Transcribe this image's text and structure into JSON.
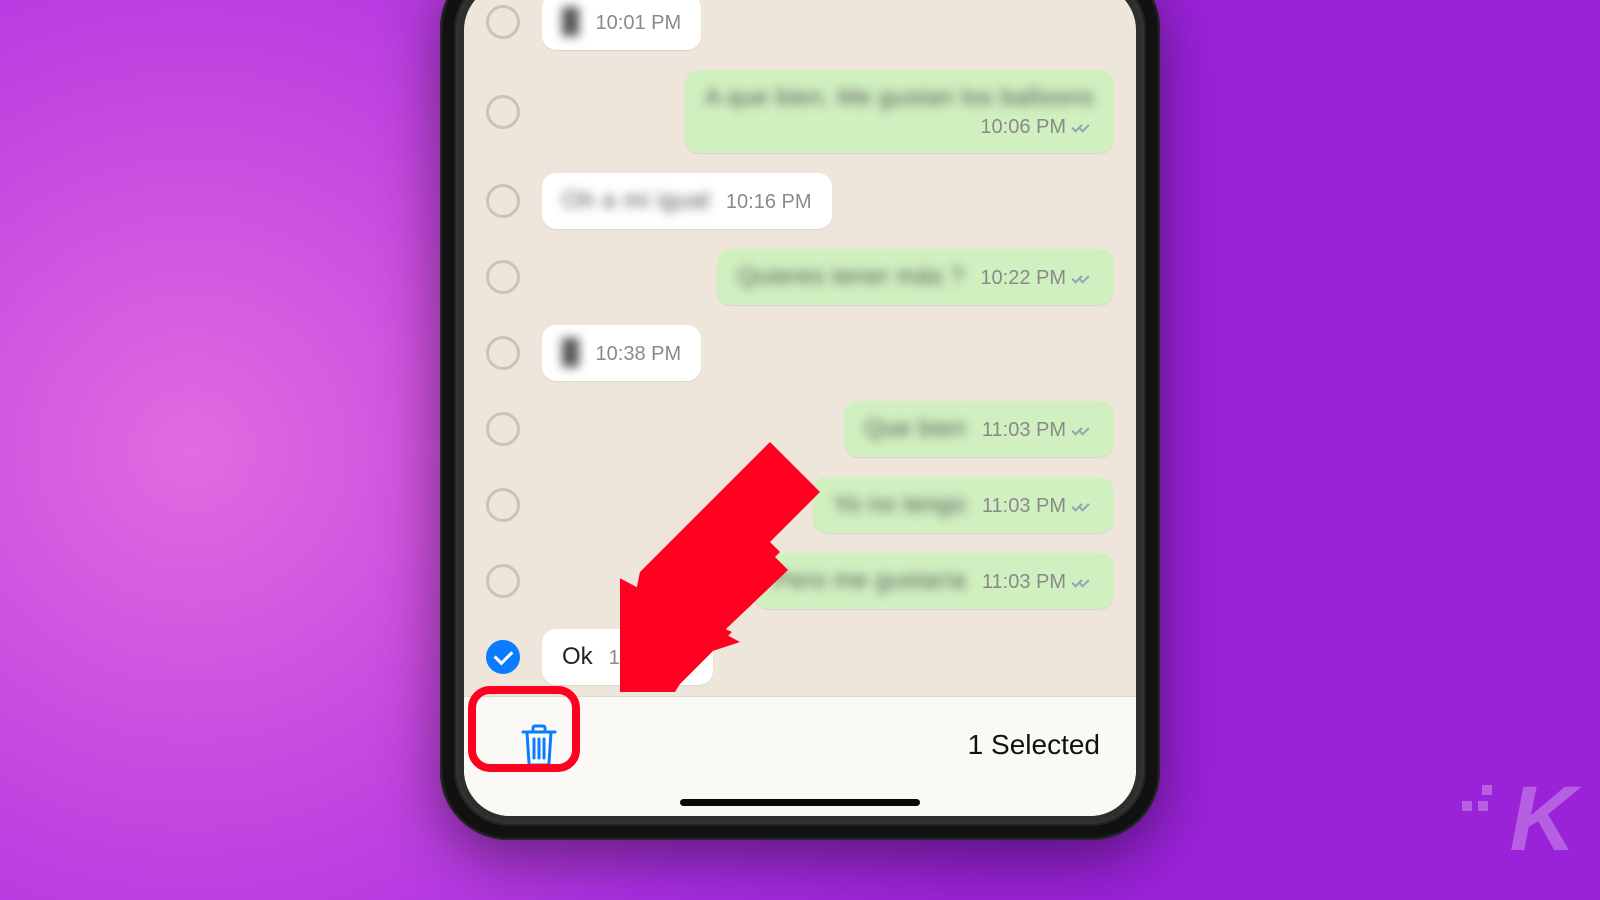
{
  "toolbar": {
    "selected_label": "1 Selected"
  },
  "messages": [
    {
      "side": "received",
      "text": "█",
      "time": "10:01 PM",
      "blur": true,
      "ticks": false,
      "selected": false
    },
    {
      "side": "sent",
      "text": "A que bien. Me gustan los balloons",
      "time": "10:06 PM",
      "blur": true,
      "ticks": true,
      "selected": false,
      "long": true
    },
    {
      "side": "received",
      "text": "Oh a mi igual",
      "time": "10:16 PM",
      "blur": true,
      "ticks": false,
      "selected": false
    },
    {
      "side": "sent",
      "text": "Quieres tener más ?",
      "time": "10:22 PM",
      "blur": true,
      "ticks": true,
      "selected": false
    },
    {
      "side": "received",
      "text": "█",
      "time": "10:38 PM",
      "blur": true,
      "ticks": false,
      "selected": false
    },
    {
      "side": "sent",
      "text": "Que bien",
      "time": "11:03 PM",
      "blur": true,
      "ticks": true,
      "selected": false
    },
    {
      "side": "sent",
      "text": "Yo no tengo",
      "time": "11:03 PM",
      "blur": true,
      "ticks": true,
      "selected": false
    },
    {
      "side": "sent",
      "text": "Pero me gustaría",
      "time": "11:03 PM",
      "blur": true,
      "ticks": true,
      "selected": false
    },
    {
      "side": "received",
      "text": "Ok",
      "time": "11:04 PM",
      "blur": false,
      "ticks": false,
      "selected": true
    }
  ],
  "icons": {
    "trash": "trash-icon"
  }
}
